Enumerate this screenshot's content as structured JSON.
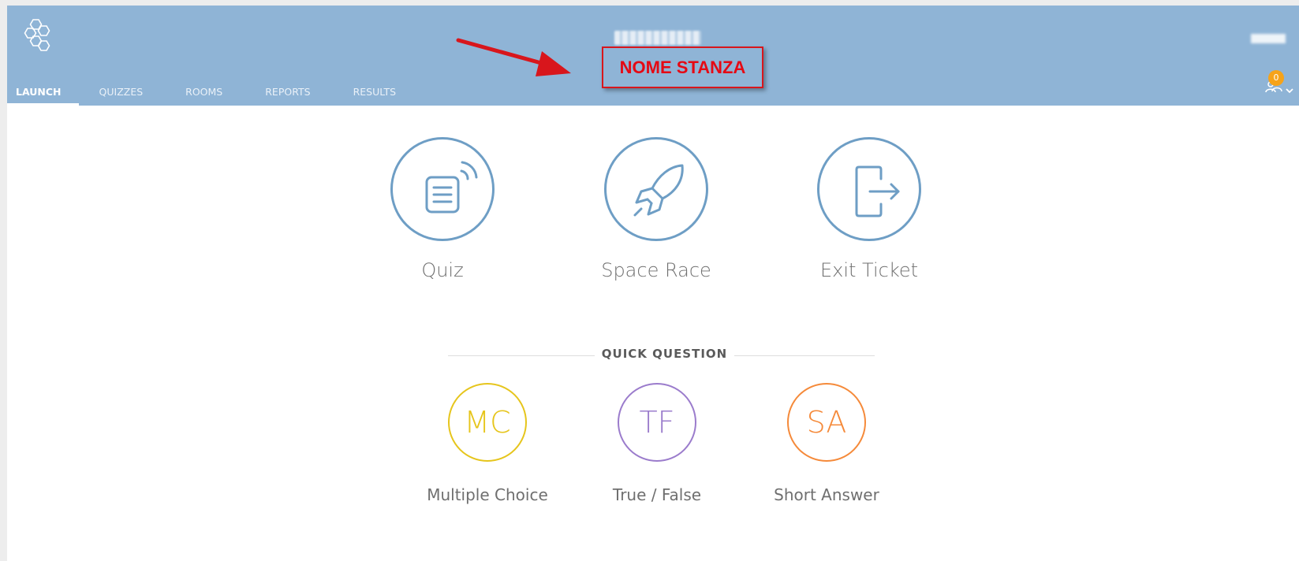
{
  "nav": {
    "tabs": [
      {
        "label": "LAUNCH",
        "active": true
      },
      {
        "label": "QUIZZES",
        "active": false
      },
      {
        "label": "ROOMS",
        "active": false
      },
      {
        "label": "REPORTS",
        "active": false
      },
      {
        "label": "RESULTS",
        "active": false
      }
    ]
  },
  "header": {
    "logo_icon": "hexagon-cluster-icon",
    "notification_count": "0",
    "notification_icon": "students-icon",
    "dropdown_icon": "chevron-down-icon"
  },
  "annotation": {
    "label": "NOME STANZA",
    "color": "#e50914"
  },
  "launch": {
    "items": [
      {
        "label": "Quiz",
        "icon": "quiz-icon"
      },
      {
        "label": "Space Race",
        "icon": "rocket-icon"
      },
      {
        "label": "Exit Ticket",
        "icon": "exit-icon"
      }
    ]
  },
  "quick_question": {
    "title": "QUICK QUESTION",
    "items": [
      {
        "abbr": "MC",
        "label": "Multiple Choice",
        "color": "#e6c51c"
      },
      {
        "abbr": "TF",
        "label": "True / False",
        "color": "#9b7ccc"
      },
      {
        "abbr": "SA",
        "label": "Short Answer",
        "color": "#f58a3a"
      }
    ]
  },
  "colors": {
    "header_bg": "#8fb4d6",
    "launch_accent": "#6e9ec5",
    "badge": "#f6a31a"
  }
}
